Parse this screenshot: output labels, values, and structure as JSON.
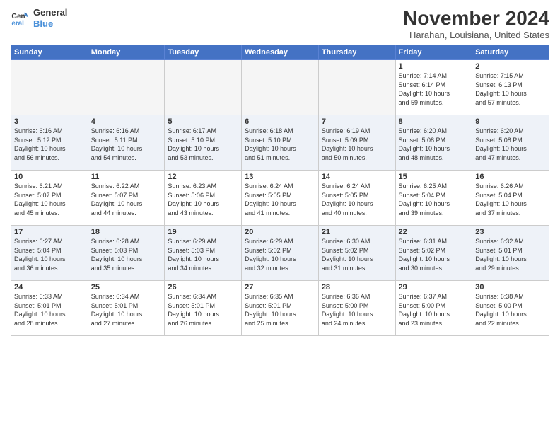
{
  "logo": {
    "line1": "General",
    "line2": "Blue"
  },
  "title": "November 2024",
  "location": "Harahan, Louisiana, United States",
  "weekdays": [
    "Sunday",
    "Monday",
    "Tuesday",
    "Wednesday",
    "Thursday",
    "Friday",
    "Saturday"
  ],
  "weeks": [
    [
      {
        "day": "",
        "info": ""
      },
      {
        "day": "",
        "info": ""
      },
      {
        "day": "",
        "info": ""
      },
      {
        "day": "",
        "info": ""
      },
      {
        "day": "",
        "info": ""
      },
      {
        "day": "1",
        "info": "Sunrise: 7:14 AM\nSunset: 6:14 PM\nDaylight: 10 hours\nand 59 minutes."
      },
      {
        "day": "2",
        "info": "Sunrise: 7:15 AM\nSunset: 6:13 PM\nDaylight: 10 hours\nand 57 minutes."
      }
    ],
    [
      {
        "day": "3",
        "info": "Sunrise: 6:16 AM\nSunset: 5:12 PM\nDaylight: 10 hours\nand 56 minutes."
      },
      {
        "day": "4",
        "info": "Sunrise: 6:16 AM\nSunset: 5:11 PM\nDaylight: 10 hours\nand 54 minutes."
      },
      {
        "day": "5",
        "info": "Sunrise: 6:17 AM\nSunset: 5:10 PM\nDaylight: 10 hours\nand 53 minutes."
      },
      {
        "day": "6",
        "info": "Sunrise: 6:18 AM\nSunset: 5:10 PM\nDaylight: 10 hours\nand 51 minutes."
      },
      {
        "day": "7",
        "info": "Sunrise: 6:19 AM\nSunset: 5:09 PM\nDaylight: 10 hours\nand 50 minutes."
      },
      {
        "day": "8",
        "info": "Sunrise: 6:20 AM\nSunset: 5:08 PM\nDaylight: 10 hours\nand 48 minutes."
      },
      {
        "day": "9",
        "info": "Sunrise: 6:20 AM\nSunset: 5:08 PM\nDaylight: 10 hours\nand 47 minutes."
      }
    ],
    [
      {
        "day": "10",
        "info": "Sunrise: 6:21 AM\nSunset: 5:07 PM\nDaylight: 10 hours\nand 45 minutes."
      },
      {
        "day": "11",
        "info": "Sunrise: 6:22 AM\nSunset: 5:07 PM\nDaylight: 10 hours\nand 44 minutes."
      },
      {
        "day": "12",
        "info": "Sunrise: 6:23 AM\nSunset: 5:06 PM\nDaylight: 10 hours\nand 43 minutes."
      },
      {
        "day": "13",
        "info": "Sunrise: 6:24 AM\nSunset: 5:05 PM\nDaylight: 10 hours\nand 41 minutes."
      },
      {
        "day": "14",
        "info": "Sunrise: 6:24 AM\nSunset: 5:05 PM\nDaylight: 10 hours\nand 40 minutes."
      },
      {
        "day": "15",
        "info": "Sunrise: 6:25 AM\nSunset: 5:04 PM\nDaylight: 10 hours\nand 39 minutes."
      },
      {
        "day": "16",
        "info": "Sunrise: 6:26 AM\nSunset: 5:04 PM\nDaylight: 10 hours\nand 37 minutes."
      }
    ],
    [
      {
        "day": "17",
        "info": "Sunrise: 6:27 AM\nSunset: 5:04 PM\nDaylight: 10 hours\nand 36 minutes."
      },
      {
        "day": "18",
        "info": "Sunrise: 6:28 AM\nSunset: 5:03 PM\nDaylight: 10 hours\nand 35 minutes."
      },
      {
        "day": "19",
        "info": "Sunrise: 6:29 AM\nSunset: 5:03 PM\nDaylight: 10 hours\nand 34 minutes."
      },
      {
        "day": "20",
        "info": "Sunrise: 6:29 AM\nSunset: 5:02 PM\nDaylight: 10 hours\nand 32 minutes."
      },
      {
        "day": "21",
        "info": "Sunrise: 6:30 AM\nSunset: 5:02 PM\nDaylight: 10 hours\nand 31 minutes."
      },
      {
        "day": "22",
        "info": "Sunrise: 6:31 AM\nSunset: 5:02 PM\nDaylight: 10 hours\nand 30 minutes."
      },
      {
        "day": "23",
        "info": "Sunrise: 6:32 AM\nSunset: 5:01 PM\nDaylight: 10 hours\nand 29 minutes."
      }
    ],
    [
      {
        "day": "24",
        "info": "Sunrise: 6:33 AM\nSunset: 5:01 PM\nDaylight: 10 hours\nand 28 minutes."
      },
      {
        "day": "25",
        "info": "Sunrise: 6:34 AM\nSunset: 5:01 PM\nDaylight: 10 hours\nand 27 minutes."
      },
      {
        "day": "26",
        "info": "Sunrise: 6:34 AM\nSunset: 5:01 PM\nDaylight: 10 hours\nand 26 minutes."
      },
      {
        "day": "27",
        "info": "Sunrise: 6:35 AM\nSunset: 5:01 PM\nDaylight: 10 hours\nand 25 minutes."
      },
      {
        "day": "28",
        "info": "Sunrise: 6:36 AM\nSunset: 5:00 PM\nDaylight: 10 hours\nand 24 minutes."
      },
      {
        "day": "29",
        "info": "Sunrise: 6:37 AM\nSunset: 5:00 PM\nDaylight: 10 hours\nand 23 minutes."
      },
      {
        "day": "30",
        "info": "Sunrise: 6:38 AM\nSunset: 5:00 PM\nDaylight: 10 hours\nand 22 minutes."
      }
    ]
  ]
}
